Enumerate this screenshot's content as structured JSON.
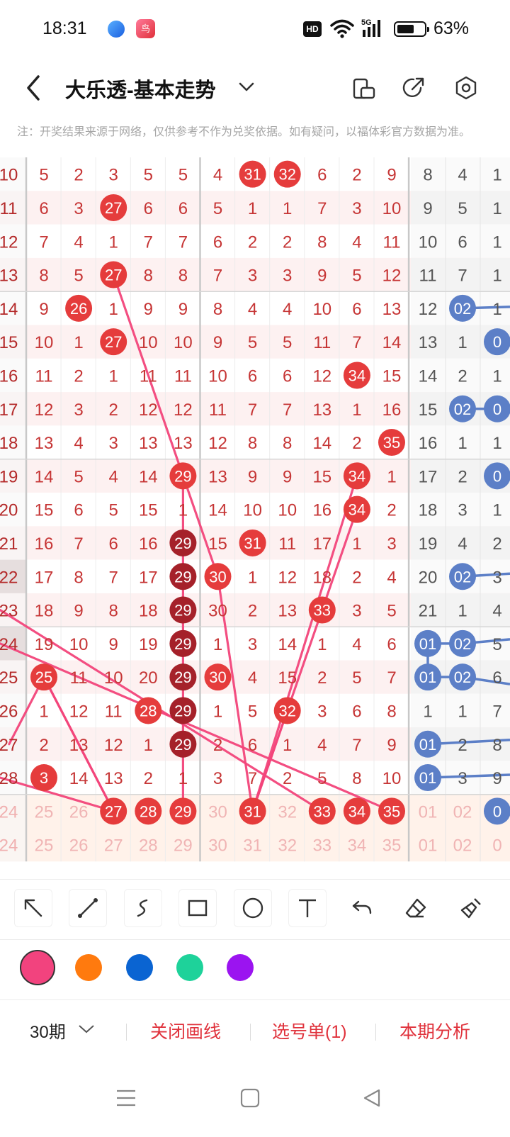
{
  "status": {
    "time": "18:31",
    "hd": "HD",
    "network": "5G",
    "battery_pct": "63%",
    "battery_level": 0.63,
    "app_icon_label": "鸟"
  },
  "header": {
    "title": "大乐透-基本走势"
  },
  "notice": "注：开奖结果来源于网络，仅供参考不作为兑奖依据。如有疑问，以福体彩官方数据为准。",
  "grid": {
    "rows": [
      {
        "issue": "10",
        "red": [
          "5",
          "2",
          "3",
          "5",
          "5",
          "4",
          "31",
          "32",
          "6",
          "2",
          "9"
        ],
        "blue": [
          "8",
          "4",
          "1"
        ]
      },
      {
        "issue": "11",
        "red": [
          "6",
          "3",
          "27",
          "6",
          "6",
          "5",
          "1",
          "1",
          "7",
          "3",
          "10"
        ],
        "blue": [
          "9",
          "5",
          "1"
        ]
      },
      {
        "issue": "12",
        "red": [
          "7",
          "4",
          "1",
          "7",
          "7",
          "6",
          "2",
          "2",
          "8",
          "4",
          "11"
        ],
        "blue": [
          "10",
          "6",
          "1"
        ]
      },
      {
        "issue": "13",
        "red": [
          "8",
          "5",
          "27",
          "8",
          "8",
          "7",
          "3",
          "3",
          "9",
          "5",
          "12"
        ],
        "blue": [
          "11",
          "7",
          "1"
        ]
      },
      {
        "issue": "14",
        "red": [
          "9",
          "26",
          "1",
          "9",
          "9",
          "8",
          "4",
          "4",
          "10",
          "6",
          "13"
        ],
        "blue": [
          "12",
          "02",
          "1"
        ]
      },
      {
        "issue": "15",
        "red": [
          "10",
          "1",
          "27",
          "10",
          "10",
          "9",
          "5",
          "5",
          "11",
          "7",
          "14"
        ],
        "blue": [
          "13",
          "1",
          "0"
        ]
      },
      {
        "issue": "16",
        "red": [
          "11",
          "2",
          "1",
          "11",
          "11",
          "10",
          "6",
          "6",
          "12",
          "34",
          "15"
        ],
        "blue": [
          "14",
          "2",
          "1"
        ]
      },
      {
        "issue": "17",
        "red": [
          "12",
          "3",
          "2",
          "12",
          "12",
          "11",
          "7",
          "7",
          "13",
          "1",
          "16"
        ],
        "blue": [
          "15",
          "02",
          "0"
        ]
      },
      {
        "issue": "18",
        "red": [
          "13",
          "4",
          "3",
          "13",
          "13",
          "12",
          "8",
          "8",
          "14",
          "2",
          "35"
        ],
        "blue": [
          "16",
          "1",
          "1"
        ]
      },
      {
        "issue": "19",
        "red": [
          "14",
          "5",
          "4",
          "14",
          "29",
          "13",
          "9",
          "9",
          "15",
          "34",
          "1"
        ],
        "blue": [
          "17",
          "2",
          "0"
        ]
      },
      {
        "issue": "20",
        "red": [
          "15",
          "6",
          "5",
          "15",
          "1",
          "14",
          "10",
          "10",
          "16",
          "34",
          "2"
        ],
        "blue": [
          "18",
          "3",
          "1"
        ]
      },
      {
        "issue": "21",
        "red": [
          "16",
          "7",
          "6",
          "16",
          "29",
          "15",
          "31",
          "11",
          "17",
          "1",
          "3"
        ],
        "blue": [
          "19",
          "4",
          "2"
        ]
      },
      {
        "issue": "22",
        "red": [
          "17",
          "8",
          "7",
          "17",
          "29",
          "30",
          "1",
          "12",
          "18",
          "2",
          "4"
        ],
        "blue": [
          "20",
          "02",
          "3"
        ]
      },
      {
        "issue": "23",
        "red": [
          "18",
          "9",
          "8",
          "18",
          "29",
          "30",
          "2",
          "13",
          "33",
          "3",
          "5"
        ],
        "blue": [
          "21",
          "1",
          "4"
        ]
      },
      {
        "issue": "24",
        "red": [
          "19",
          "10",
          "9",
          "19",
          "29",
          "1",
          "3",
          "14",
          "1",
          "4",
          "6"
        ],
        "blue": [
          "01",
          "02",
          "5"
        ]
      },
      {
        "issue": "25",
        "red": [
          "25",
          "11",
          "10",
          "20",
          "29",
          "30",
          "4",
          "15",
          "2",
          "5",
          "7"
        ],
        "blue": [
          "01",
          "02",
          "6"
        ]
      },
      {
        "issue": "26",
        "red": [
          "1",
          "12",
          "11",
          "28",
          "29",
          "1",
          "5",
          "32",
          "3",
          "6",
          "8"
        ],
        "blue": [
          "1",
          "1",
          "7"
        ]
      },
      {
        "issue": "27",
        "red": [
          "2",
          "13",
          "12",
          "1",
          "29",
          "2",
          "6",
          "1",
          "4",
          "7",
          "9"
        ],
        "blue": [
          "01",
          "2",
          "8"
        ]
      },
      {
        "issue": "28",
        "red": [
          "3",
          "14",
          "13",
          "2",
          "1",
          "3",
          "7",
          "2",
          "5",
          "8",
          "10"
        ],
        "blue": [
          "01",
          "3",
          "9"
        ]
      },
      {
        "issue": "24",
        "red": [
          "25",
          "26",
          "27",
          "28",
          "29",
          "30",
          "31",
          "32",
          "33",
          "34",
          "35"
        ],
        "blue": [
          "01",
          "02",
          "0"
        ]
      },
      {
        "issue": "24",
        "red": [
          "25",
          "26",
          "27",
          "28",
          "29",
          "30",
          "31",
          "32",
          "33",
          "34",
          "35"
        ],
        "blue": [
          "01",
          "02",
          "0"
        ]
      }
    ],
    "red_hits": [
      [
        0,
        6
      ],
      [
        0,
        7
      ],
      [
        1,
        2
      ],
      [
        3,
        2
      ],
      [
        4,
        1
      ],
      [
        5,
        2
      ],
      [
        6,
        9
      ],
      [
        8,
        10
      ],
      [
        9,
        4
      ],
      [
        9,
        9
      ],
      [
        10,
        9
      ],
      [
        11,
        6
      ],
      [
        12,
        5
      ],
      [
        13,
        8
      ],
      [
        14,
        4
      ],
      [
        15,
        0
      ],
      [
        15,
        5
      ],
      [
        16,
        3
      ],
      [
        16,
        7
      ],
      [
        18,
        0
      ]
    ],
    "dark_hits": [
      [
        11,
        4
      ],
      [
        12,
        4
      ],
      [
        13,
        4
      ],
      [
        14,
        4
      ],
      [
        15,
        4
      ],
      [
        16,
        4
      ],
      [
        17,
        4
      ]
    ],
    "blue_hits": [
      [
        4,
        1
      ],
      [
        5,
        2
      ],
      [
        7,
        1
      ],
      [
        7,
        2
      ],
      [
        9,
        2
      ],
      [
        12,
        1
      ],
      [
        14,
        0
      ],
      [
        14,
        1
      ],
      [
        15,
        0
      ],
      [
        15,
        1
      ],
      [
        17,
        0
      ],
      [
        18,
        0
      ]
    ],
    "selected_red": [
      2,
      3,
      4,
      6,
      8,
      9,
      10
    ],
    "selected_blue": [
      2
    ],
    "colors": {
      "red": "#e53c3c",
      "dark": "#a5212a",
      "blue": "#5c7fc7",
      "pink_line": "#f2457a",
      "blue_line": "#5c7fc7"
    }
  },
  "tools": [
    "arrow-tool",
    "line-tool",
    "curve-tool",
    "rectangle-tool",
    "circle-tool",
    "text-tool",
    "undo-tool",
    "eraser-tool",
    "clear-tool"
  ],
  "pen_colors": [
    "#f2437e",
    "#ff7a0e",
    "#0a64d2",
    "#1ed29a",
    "#9b14f0"
  ],
  "actions": {
    "period": "30期",
    "close_lines": "关闭画线",
    "pick_list": "选号单(1)",
    "analysis": "本期分析"
  }
}
